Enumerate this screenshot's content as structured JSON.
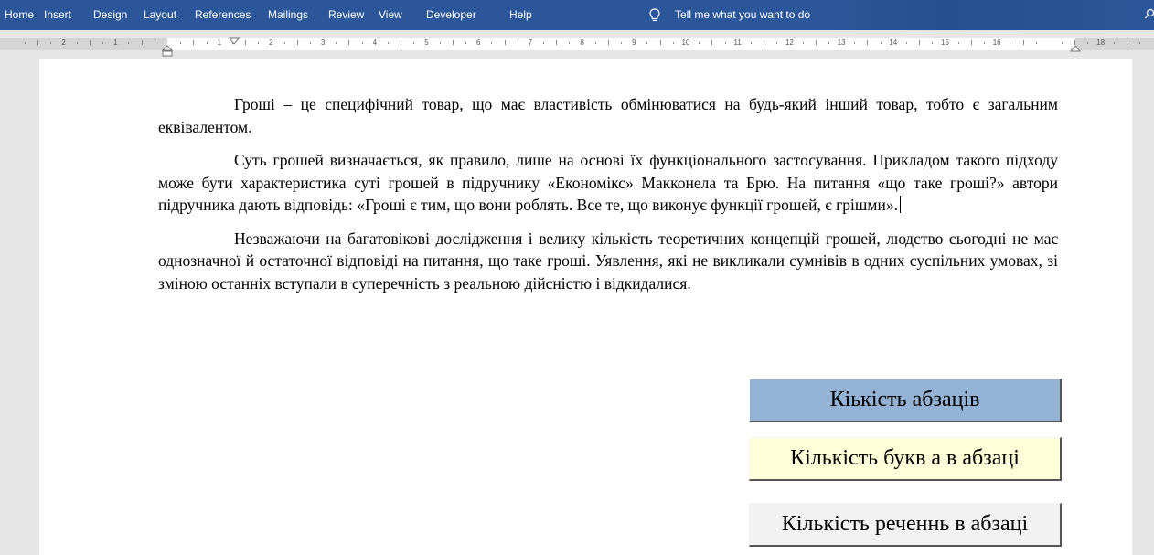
{
  "ribbon": {
    "tabs": [
      "Home",
      "Insert",
      "Design",
      "Layout",
      "References",
      "Mailings",
      "Review",
      "View",
      "Developer",
      "Help"
    ],
    "tell_me": "Tell me what you want to do",
    "tell_me_icon": "lightbulb-icon",
    "search_icon": "search-icon"
  },
  "ruler": {
    "labels": [
      "2",
      "1",
      "1",
      "2",
      "3",
      "4",
      "5",
      "6",
      "7",
      "8",
      "9",
      "10",
      "11",
      "12",
      "13",
      "14",
      "15",
      "16",
      "18"
    ]
  },
  "document": {
    "paragraphs": [
      "Гроші – це специфічний товар, що має властивість обмінюватися на будь-який інший товар, тобто є загальним еквівалентом.",
      "Суть грошей визначається, як правило, лише на основі їх функціонального застосування. Прикладом такого підходу може бути характеристика суті грошей в підручнику «Економікс» Макконела та Брю. На питання «що таке гроші?» автори підручника дають відповідь: «Гроші є тим, що вони роблять. Все те, що виконує функції грошей, є грішми».",
      "Незважаючи на багатовікові дослідження і велику кількість теоретичних концепцій грошей, людство сьогодні не має однозначної й остаточної відповіді на питання, що таке гроші. Уявлення, які не викликали сумнівів в одних суспільних умовах, зі зміною останніх вступали в суперечність з реальною дійсністю і відкидалися."
    ]
  },
  "buttons": {
    "paragraph_count": "Кiькiсть абзацiв",
    "letter_a_count": "Кiлькiсть букв а в абзацi",
    "sentence_count": "Кiлькiсть реченнь в абзацi"
  },
  "colors": {
    "ribbon": "#2b579a",
    "paragraph_count_button": "#94b3d4",
    "letter_a_count_button": "#ffffd9",
    "sentence_count_button": "#f2f2f2"
  }
}
